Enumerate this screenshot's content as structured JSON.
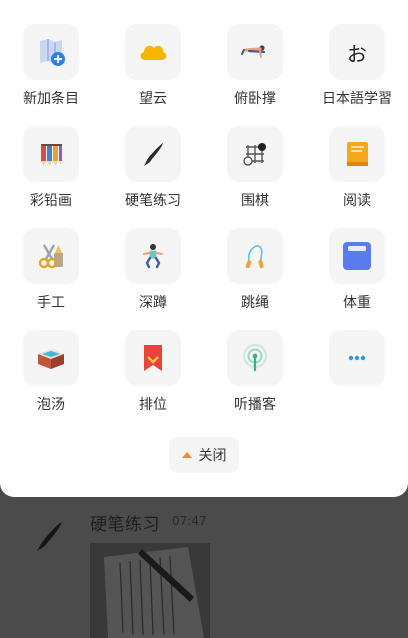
{
  "panel": {
    "items": [
      {
        "label": "新加条目",
        "icon": "add-entry-icon"
      },
      {
        "label": "望云",
        "icon": "cloud-icon"
      },
      {
        "label": "俯卧撑",
        "icon": "push-up-icon"
      },
      {
        "label": "日本語学習",
        "icon": "hiragana-o-icon",
        "glyph": "お"
      },
      {
        "label": "彩铅画",
        "icon": "colored-pencils-icon"
      },
      {
        "label": "硬笔练习",
        "icon": "pen-icon"
      },
      {
        "label": "围棋",
        "icon": "go-board-icon"
      },
      {
        "label": "阅读",
        "icon": "book-icon"
      },
      {
        "label": "手工",
        "icon": "scissors-icon"
      },
      {
        "label": "深蹲",
        "icon": "squat-icon"
      },
      {
        "label": "跳绳",
        "icon": "jump-rope-icon"
      },
      {
        "label": "体重",
        "icon": "scale-icon"
      },
      {
        "label": "泡汤",
        "icon": "bath-icon"
      },
      {
        "label": "排位",
        "icon": "rank-ribbon-icon"
      },
      {
        "label": "听播客",
        "icon": "podcast-icon"
      },
      {
        "label": "",
        "icon": "more-icon"
      }
    ],
    "close_label": "关闭"
  },
  "background": {
    "entry_title": "硬笔练习",
    "entry_time": "07:47"
  },
  "colors": {
    "cloud": "#f7b500",
    "scale": "#5b7cf0",
    "more": "#2f96e8",
    "rank": "#e8423c",
    "close_arrow": "#f08a3c"
  }
}
